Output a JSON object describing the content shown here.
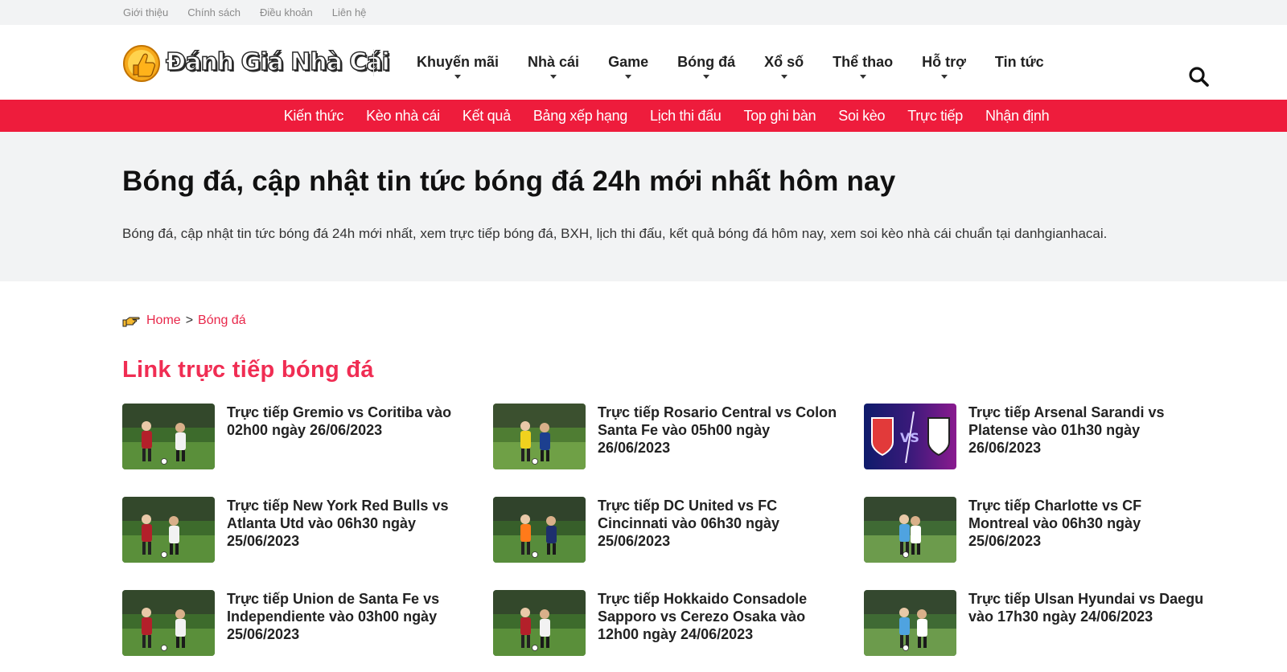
{
  "topbar": {
    "links": [
      "Giới thiệu",
      "Chính sách",
      "Điều khoản",
      "Liên hệ"
    ]
  },
  "header": {
    "logo_text": "Đánh Giá Nhà Cái",
    "nav": [
      "Khuyến mãi",
      "Nhà cái",
      "Game",
      "Bóng đá",
      "Xổ số",
      "Thể thao",
      "Hỗ trợ",
      "Tin tức"
    ],
    "nav_has_caret": [
      true,
      true,
      true,
      true,
      true,
      true,
      true,
      false
    ]
  },
  "subnav": {
    "links": [
      "Kiến thức",
      "Kèo nhà cái",
      "Kết quả",
      "Bảng xếp hạng",
      "Lịch thi đấu",
      "Top ghi bàn",
      "Soi kèo",
      "Trực tiếp",
      "Nhận định"
    ]
  },
  "hero": {
    "title": "Bóng đá, cập nhật tin tức bóng đá 24h mới nhất hôm nay",
    "description": "Bóng đá, cập nhật tin tức bóng đá 24h mới nhất, xem trực tiếp bóng đá, BXH, lịch thi đấu, kết quả bóng đá hôm nay, xem soi kèo nhà cái chuẩn tại danhgianhacai."
  },
  "breadcrumb": {
    "home": "Home",
    "separator": ">",
    "current": "Bóng đá"
  },
  "section": {
    "title": "Link trực tiếp bóng đá"
  },
  "articles": [
    {
      "title": "Trực tiếp Gremio vs Coritiba vào 02h00 ngày 26/06/2023",
      "thumb": "pitch-red"
    },
    {
      "title": "Trực tiếp Rosario Central vs Colon Santa Fe vào 05h00 ngày 26/06/2023",
      "thumb": "pitch-yellow"
    },
    {
      "title": "Trực tiếp Arsenal Sarandi vs Platense vào 01h30 ngày 26/06/2023",
      "thumb": "versus"
    },
    {
      "title": "Trực tiếp New York Red Bulls vs Atlanta Utd vào 06h30 ngày 25/06/2023",
      "thumb": "pitch-red"
    },
    {
      "title": "Trực tiếp DC United vs FC Cincinnati vào 06h30 ngày 25/06/2023",
      "thumb": "pitch-orange"
    },
    {
      "title": "Trực tiếp Charlotte vs CF Montreal vào 06h30 ngày 25/06/2023",
      "thumb": "pitch-blue"
    },
    {
      "title": "Trực tiếp Union de Santa Fe vs Independiente vào 03h00 ngày 25/06/2023",
      "thumb": "pitch-red"
    },
    {
      "title": "Trực tiếp Hokkaido Consadole Sapporo vs Cerezo Osaka vào 12h00 ngày 24/06/2023",
      "thumb": "pitch-red"
    },
    {
      "title": "Trực tiếp Ulsan Hyundai vs Daegu vào 17h30 ngày 24/06/2023",
      "thumb": "pitch-blue"
    }
  ],
  "colors": {
    "accent_red": "#ee1c3c",
    "title_pink": "#f02d53",
    "hero_bg": "#f2f3f4"
  }
}
